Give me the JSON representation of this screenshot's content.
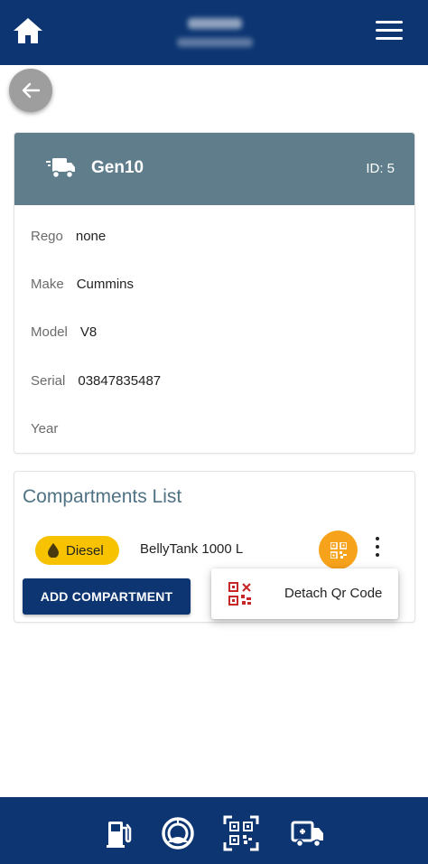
{
  "header": {
    "home_icon": "home-icon",
    "menu_icon": "hamburger-menu-icon"
  },
  "back_icon": "arrow-left-icon",
  "asset": {
    "icon": "truck-icon",
    "name": "Gen10",
    "id_label": "ID: 5",
    "header_color": "#607d8b",
    "fields": [
      {
        "label": "Rego",
        "value": "none"
      },
      {
        "label": "Make",
        "value": "Cummins"
      },
      {
        "label": "Model",
        "value": "V8"
      },
      {
        "label": "Serial",
        "value": "03847835487"
      },
      {
        "label": "Year",
        "value": ""
      }
    ]
  },
  "compartments": {
    "title": "Compartments List",
    "items": [
      {
        "fuel_type": "Diesel",
        "fuel_icon": "fuel-drop-icon",
        "name": "BellyTank 1000 L",
        "chip_color": "#f7c300"
      }
    ],
    "add_button_label": "ADD COMPARTMENT"
  },
  "context_menu": {
    "items": [
      {
        "label": "Detach Qr Code",
        "icon": "qr-code-detach-icon"
      }
    ]
  },
  "bottom_nav": {
    "items": [
      {
        "icon": "fuel-pump-icon"
      },
      {
        "icon": "gauge-icon"
      },
      {
        "icon": "qr-scan-icon"
      },
      {
        "icon": "service-truck-icon"
      }
    ]
  },
  "colors": {
    "primary": "#0c3572",
    "accent_orange": "#f7a21b",
    "title_teal": "#4f7285",
    "detach_red": "#c62828"
  }
}
